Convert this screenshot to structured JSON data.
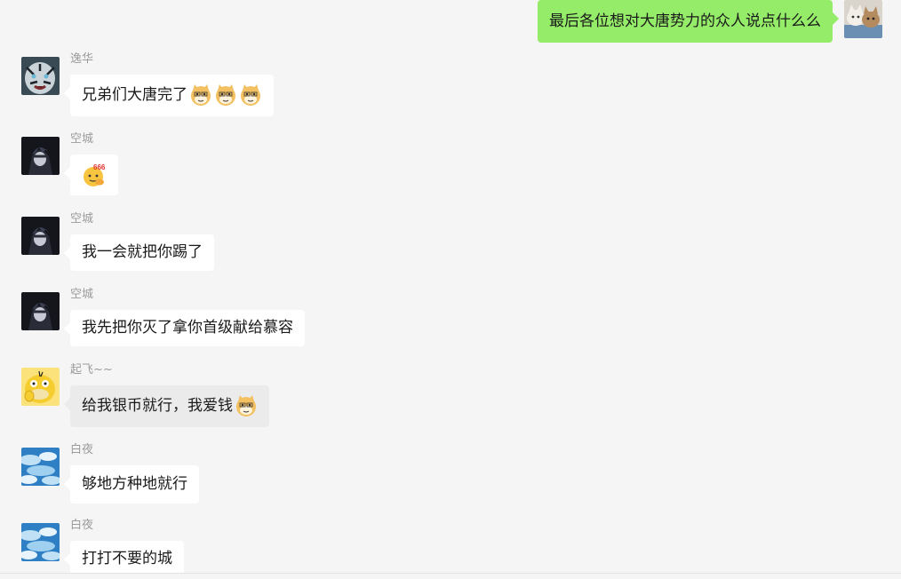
{
  "messages": [
    {
      "sender": "",
      "text": "最后各位想对大唐势力的众人说点什么么",
      "mine": true
    },
    {
      "sender": "逸华",
      "text": "兄弟们大唐完了",
      "emoji": [
        "doge-emoji",
        "doge-emoji",
        "doge-emoji"
      ]
    },
    {
      "sender": "空城",
      "text": "",
      "emoji": [
        "666-emoji"
      ]
    },
    {
      "sender": "空城",
      "text": "我一会就把你踢了"
    },
    {
      "sender": "空城",
      "text": "我先把你灭了拿你首级献给慕容"
    },
    {
      "sender": "起飞~~",
      "text": "给我银币就行，我爱钱",
      "emoji": [
        "doge-emoji"
      ]
    },
    {
      "sender": "白夜",
      "text": "够地方种地就行"
    },
    {
      "sender": "白夜",
      "text": "打打不要的城"
    }
  ],
  "colors": {
    "background": "#f5f5f5",
    "bubble_mine": "#95ec69",
    "bubble_other": "#ffffff",
    "sender_name": "#9b9b9b"
  }
}
